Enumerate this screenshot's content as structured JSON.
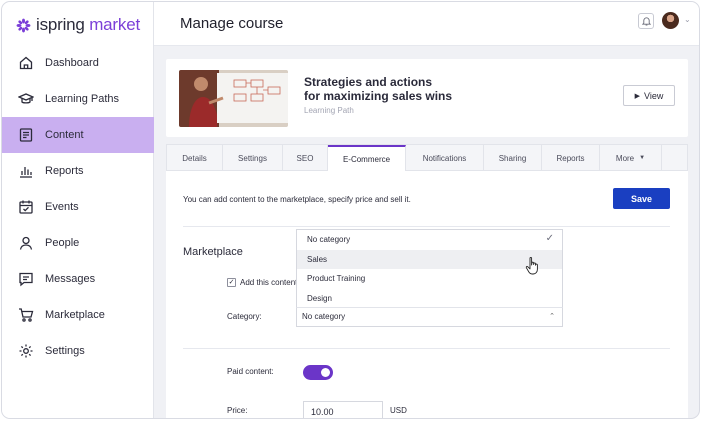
{
  "app": {
    "logo_prefix": "ispring",
    "logo_suffix": " market"
  },
  "sidebar": {
    "items": [
      {
        "label": "Dashboard",
        "icon": "home-icon",
        "active": false
      },
      {
        "label": "Learning Paths",
        "icon": "graduation-cap-icon",
        "active": false
      },
      {
        "label": "Content",
        "icon": "document-icon",
        "active": true
      },
      {
        "label": "Reports",
        "icon": "bar-chart-icon",
        "active": false
      },
      {
        "label": "Events",
        "icon": "calendar-icon",
        "active": false
      },
      {
        "label": "People",
        "icon": "person-icon",
        "active": false
      },
      {
        "label": "Messages",
        "icon": "message-icon",
        "active": false
      },
      {
        "label": "Marketplace",
        "icon": "cart-icon",
        "active": false
      },
      {
        "label": "Settings",
        "icon": "gear-icon",
        "active": false
      }
    ]
  },
  "header": {
    "title": "Manage course"
  },
  "course": {
    "title_line1": "Strategies and actions",
    "title_line2": "for maximizing sales wins",
    "subtitle": "Learning Path",
    "view_label": "View"
  },
  "tabs": [
    {
      "label": "Details"
    },
    {
      "label": "Settings"
    },
    {
      "label": "SEO"
    },
    {
      "label": "E-Commerce",
      "active": true
    },
    {
      "label": "Notifications"
    },
    {
      "label": "Sharing"
    },
    {
      "label": "Reports"
    },
    {
      "label": "More"
    }
  ],
  "ecommerce": {
    "info": "You can add content to the marketplace, specify price and sell it.",
    "save_label": "Save",
    "section_title": "Marketplace",
    "add_checkbox_label": "Add this content",
    "category_label": "Category:",
    "category_value": "No category",
    "category_options": [
      "No category",
      "Sales",
      "Product Training",
      "Design"
    ],
    "category_hovered": "Sales",
    "paid_label": "Paid content:",
    "paid_enabled": true,
    "price_label": "Price:",
    "price_value": "10.00",
    "currency": "USD"
  },
  "colors": {
    "accent": "#6b35c8",
    "active_nav": "#c9aff0",
    "save_button": "#1a3fc1"
  }
}
